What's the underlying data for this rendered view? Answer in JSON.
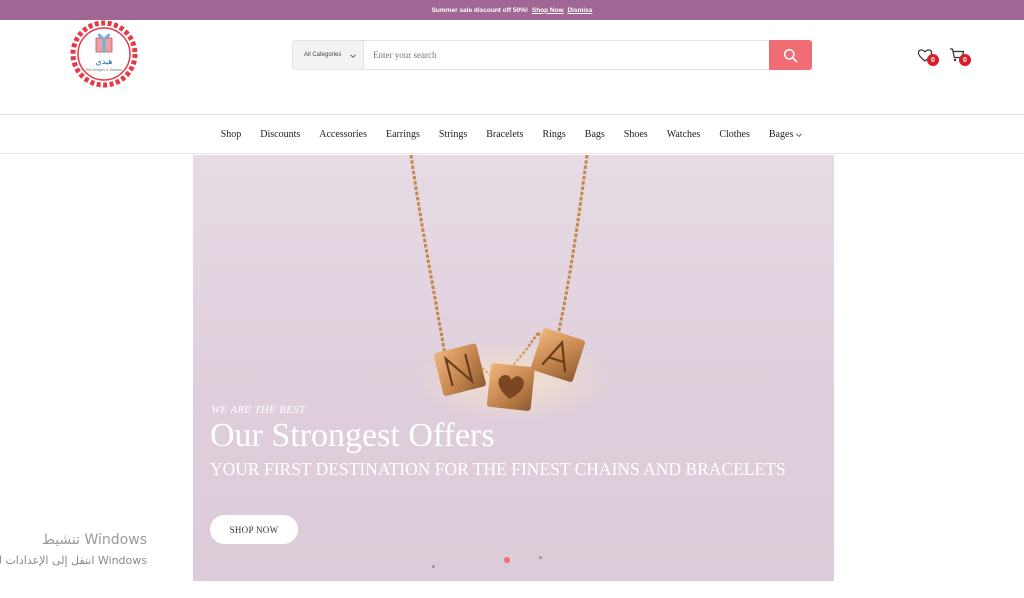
{
  "topbar": {
    "message": "Summer sale discount off 50%!",
    "link_shop": "Shop Now",
    "link_dismiss": "Dismiss"
  },
  "header": {
    "logo_text": "هيدي",
    "logo_tagline": "For designs & dresses",
    "search": {
      "category_selected": "All Categories",
      "placeholder": "Enter your search",
      "value": ""
    },
    "wishlist_count": "0",
    "cart_count": "0"
  },
  "nav": {
    "items": [
      "Shop",
      "Discounts",
      "Accessories",
      "Earrings",
      "Strings",
      "Bracelets",
      "Rings",
      "Bags",
      "Shoes",
      "Watches",
      "Clothes",
      "Bages"
    ]
  },
  "hero": {
    "eyebrow": "WE ARE THE BEST",
    "headline": "Our Strongest Offers",
    "subheadline": "YOUR FIRST DESTINATION FOR THE FINEST CHAINS AND BRACELETS",
    "cta": "SHOP NOW"
  },
  "watermark": {
    "line1": "تنشيط Windows",
    "line2": "انتقل إلى الإعدادات لتنشيط Windows"
  },
  "colors": {
    "topbar": "#a06694",
    "search_button": "#ef6d73",
    "badge": "#d81e2a",
    "hero_bg": "#e2d4e0"
  }
}
